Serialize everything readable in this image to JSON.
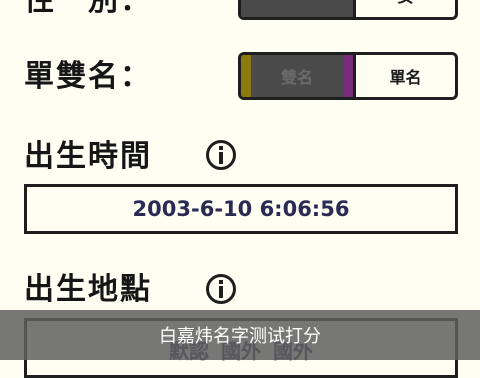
{
  "gender": {
    "label": "性　別：",
    "options": [
      "",
      "女"
    ]
  },
  "single_name": {
    "label": "單雙名：",
    "options": [
      "雙名",
      "單名"
    ],
    "selected_colors": [
      "#8a7a10",
      "#7a2a7a"
    ]
  },
  "birth_time": {
    "label": "出生時間",
    "value": "2003-6-10 6:06:56"
  },
  "birth_place": {
    "label": "出生地點",
    "options": [
      "默認",
      "國外",
      "國外"
    ]
  },
  "subtitle": "白嘉炜名字测试打分",
  "colors": {
    "background": "#fefef2",
    "border": "#1e1e1e",
    "selected": "#4a4a4a",
    "value_text": "#2a2a55"
  },
  "icons": {
    "info": "info-icon"
  }
}
